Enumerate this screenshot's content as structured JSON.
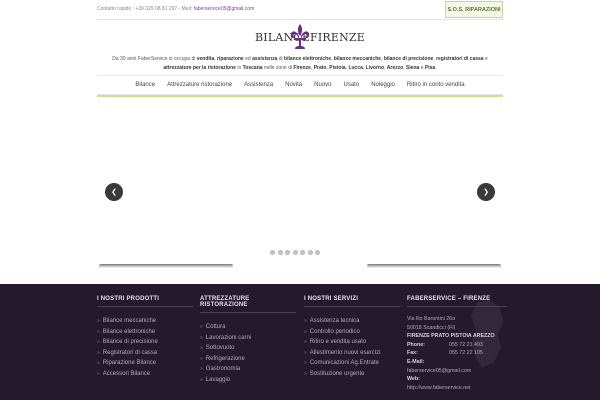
{
  "topbar": {
    "contact_prefix": "Contatto rapido : +39 329 08 81 297 - Mail:",
    "email": "faberservice05@gmail.com",
    "sos_label": "S.O.S. RIPARAZIONI"
  },
  "logo": {
    "word1": "BILANCE",
    "word2": "FIRENZE"
  },
  "intro": {
    "t1": "Da 30 anni FaberService si occupa di ",
    "b1": "vendita",
    "t2": ", ",
    "b2": "riparazione",
    "t3": " ed ",
    "b3": "assistenza",
    "t4": " di ",
    "b4": "bilance elettroniche",
    "t5": ", ",
    "b5": "bilance meccaniche",
    "t6": ", ",
    "b6": "bilance di precisione",
    "t7": ", ",
    "b7": "registratori di cassa",
    "t8": " e ",
    "b8": "attrezzature per la ristorazione",
    "t9": " in ",
    "b9": "Toscana",
    "t10": " nelle zone di ",
    "b10": "Firenze",
    "t11": ", ",
    "b11": "Prato",
    "t12": ", ",
    "b12": "Pistoia",
    "t13": ", ",
    "b13": "Lucca",
    "t14": ", ",
    "b14": "Livorno",
    "t15": ", ",
    "b15": "Arezzo",
    "t16": ", ",
    "b16": "Siena",
    "t17": " e ",
    "b17": "Pisa",
    "t18": "."
  },
  "nav": {
    "items": [
      "Bilance",
      "Attrezzature ristorazione",
      "Assistenza",
      "Novità",
      "Nuovo",
      "Usato",
      "Noleggio",
      "Ritiro in conto vendita"
    ]
  },
  "slider": {
    "prev_glyph": "❮",
    "next_glyph": "❯",
    "dot_count": 7
  },
  "footer": {
    "col1": {
      "title": "I NOSTRI PRODOTTI",
      "items": [
        "Bilance meccaniche",
        "Bilance elettroniche",
        "Bilance di precisione",
        "Registratori di cassa",
        "Riparazione Bilance",
        "Accessori Bilance"
      ]
    },
    "col2": {
      "title": "ATTREZZATURE RISTORAZIONE",
      "items": [
        "Cottura",
        "Lavorazioni carni",
        "Sottovuoto",
        "Refrigerazione",
        "Gastronomia",
        "Lavaggio"
      ]
    },
    "col3": {
      "title": "I NOSTRI SERVIZI",
      "items": [
        "Assistenza tecnica",
        "Controllo periodico",
        "Ritiro e vendita usato",
        "Allestimento nuovi esercizi",
        "Comunicazioni Ag.Entrate",
        "Sostituzione urgente"
      ]
    },
    "col4": {
      "title": "FABERSERVICE – FIRENZE",
      "address1": "Via llio Barontini 26a",
      "address2": "50018 Scandicci (Fi)",
      "cities": "FIRENZE PRATO PISTOIA AREZZO",
      "phone_label": "Phone:",
      "phone": "055 72 21 493",
      "fax_label": "Fax:",
      "fax": "055 72 22 105",
      "email_label": "E-Mail:",
      "email": "faberservice05@gmail.com",
      "web_label": "Web:",
      "web": "http://www.faberservice.net"
    },
    "bullet": "»"
  },
  "colors": {
    "accent_green": "#cfe08a",
    "footer_bg": "#241a2b",
    "lily_purple": "#6b2d8a"
  }
}
